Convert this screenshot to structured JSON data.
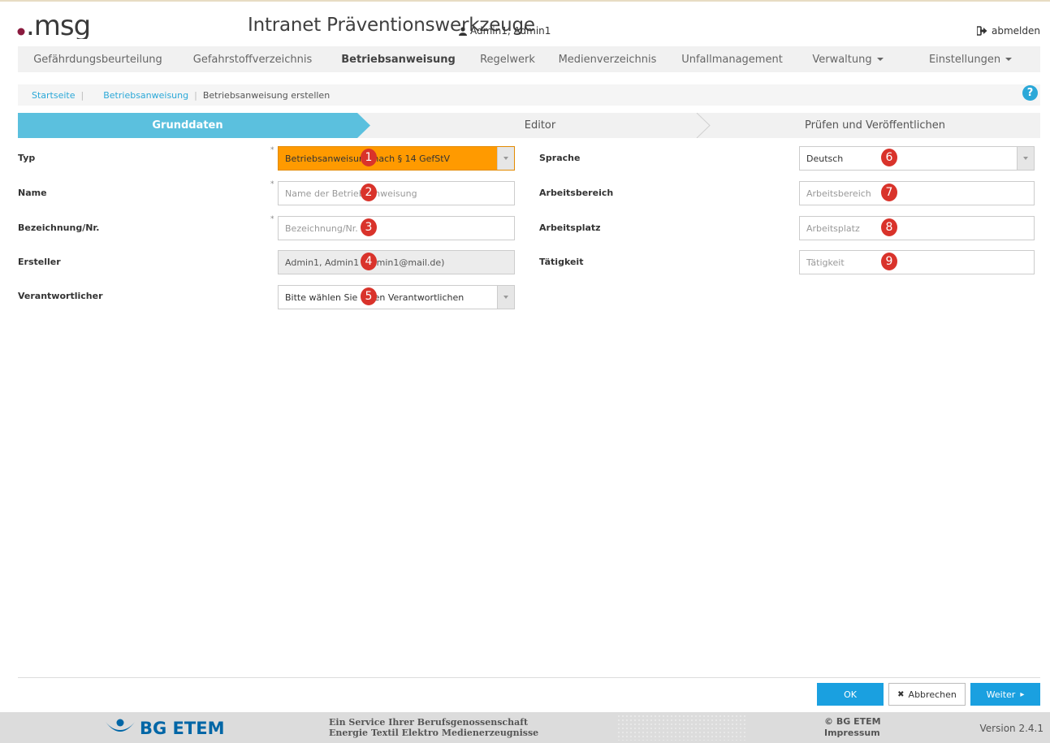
{
  "header": {
    "logo_text": ".msg",
    "app_title": "Intranet Präventionswerkzeuge",
    "user_name": "Admin1, Admin1",
    "user_icon": "user-icon",
    "logout_label": "abmelden",
    "logout_icon": "sign-out-icon"
  },
  "nav": {
    "items": [
      {
        "label": "Gefährdungsbeurteilung"
      },
      {
        "label": "Gefahrstoffverzeichnis"
      },
      {
        "label": "Betriebsanweisung",
        "active": true
      },
      {
        "label": "Regelwerk"
      },
      {
        "label": "Medienverzeichnis"
      },
      {
        "label": "Unfallmanagement"
      },
      {
        "label": "Verwaltung",
        "dropdown": true
      },
      {
        "label": "Einstellungen",
        "dropdown": true
      }
    ]
  },
  "breadcrumb": {
    "items": [
      "Startseite",
      "Betriebsanweisung",
      "Betriebsanweisung erstellen"
    ],
    "help_icon": "question-circle-icon",
    "help_symbol": "?"
  },
  "steps": [
    {
      "label": "Grunddaten",
      "active": true
    },
    {
      "label": "Editor"
    },
    {
      "label": "Prüfen und Veröffentlichen"
    }
  ],
  "form": {
    "left": [
      {
        "label": "Typ",
        "required": true,
        "type": "select",
        "value": "Betriebsanweisung nach § 14 GefStV",
        "badge": "1"
      },
      {
        "label": "Name",
        "required": true,
        "type": "input",
        "placeholder": "Name der Betriebsanweisung",
        "badge": "2"
      },
      {
        "label": "Bezeichnung/Nr.",
        "required": true,
        "type": "input",
        "placeholder": "Bezeichnung/Nr.",
        "badge": "3"
      },
      {
        "label": "Ersteller",
        "required": false,
        "type": "readonly",
        "value": "Admin1, Admin1 (admin1@mail.de)",
        "badge": "4"
      },
      {
        "label": "Verantwortlicher",
        "required": false,
        "type": "select",
        "value": "Bitte wählen Sie einen Verantwortlichen",
        "badge": "5"
      }
    ],
    "right": [
      {
        "label": "Sprache",
        "type": "select",
        "value": "Deutsch",
        "badge": "6"
      },
      {
        "label": "Arbeitsbereich",
        "type": "input",
        "placeholder": "Arbeitsbereich",
        "badge": "7"
      },
      {
        "label": "Arbeitsplatz",
        "type": "input",
        "placeholder": "Arbeitsplatz",
        "badge": "8"
      },
      {
        "label": "Tätigkeit",
        "type": "input",
        "placeholder": "Tätigkeit",
        "badge": "9"
      }
    ],
    "required_marker": "*"
  },
  "actions": {
    "ok_label": "OK",
    "cancel_label": "Abbrechen",
    "cancel_symbol": "✖",
    "next_label": "Weiter",
    "next_symbol": "▸"
  },
  "footer": {
    "brand": "BG ETEM",
    "service_line1": "Ein Service Ihrer Berufsgenossenschaft",
    "service_line2": "Energie Textil Elektro Medienerzeugnisse",
    "copyright": "© BG ETEM",
    "impressum": "Impressum",
    "version": "Version 2.4.1"
  },
  "colors": {
    "accent": "#2ba8d8",
    "active_step": "#5bc0de",
    "type_select": "#ff9a00",
    "badge": "#d9332b",
    "logo_dot": "#8a1a3e",
    "brand_blue": "#0066a6"
  }
}
